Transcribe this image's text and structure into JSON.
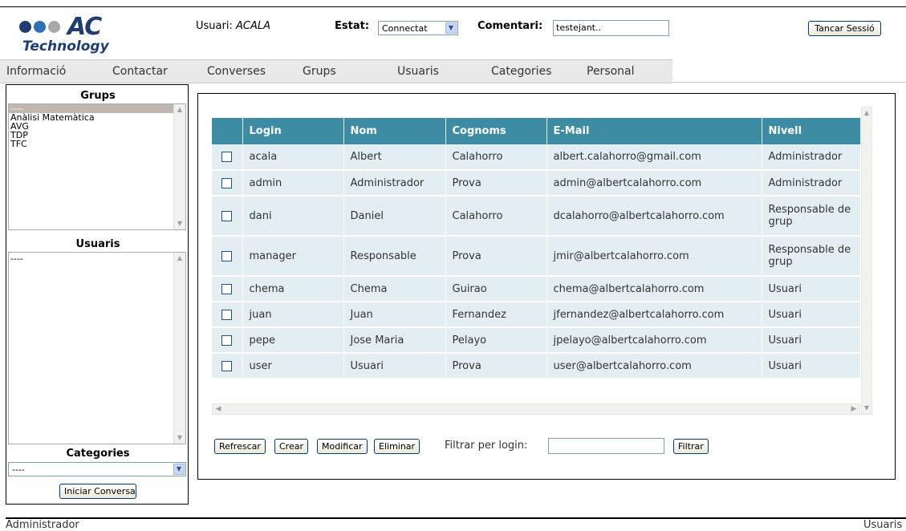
{
  "logo": {
    "brand": "AC",
    "tagline": "Technology",
    "dot_colors": [
      "#1f3d72",
      "#2f6fb4",
      "#a8a8a8"
    ]
  },
  "header": {
    "user_label": "Usuari:",
    "user_value": "ACALA",
    "status_label": "Estat:",
    "status_value": "Connectat",
    "comment_label": "Comentari:",
    "comment_value": "testejant..",
    "logout_label": "Tancar Sessió"
  },
  "menu": [
    "Informació",
    "Contactar",
    "Converses",
    "Grups",
    "Usuaris",
    "Categories",
    "Personal"
  ],
  "sidebar": {
    "groups_title": "Grups",
    "groups": [
      "----",
      "Anàlisi Matemàtica",
      "AVG",
      "TDP",
      "TFC"
    ],
    "users_title": "Usuaris",
    "users": [
      "----"
    ],
    "categories_title": "Categories",
    "categories_value": "----",
    "start_conversation_label": "Iniciar Conversa"
  },
  "table": {
    "headers": [
      "Login",
      "Nom",
      "Cognoms",
      "E-Mail",
      "Nivell"
    ],
    "rows": [
      [
        "acala",
        "Albert",
        "Calahorro",
        "albert.calahorro@gmail.com",
        "Administrador"
      ],
      [
        "admin",
        "Administrador",
        "Prova",
        "admin@albertcalahorro.com",
        "Administrador"
      ],
      [
        "dani",
        "Daniel",
        "Calahorro",
        "dcalahorro@albertcalahorro.com",
        "Responsable de grup"
      ],
      [
        "manager",
        "Responsable",
        "Prova",
        "jmir@albertcalahorro.com",
        "Responsable de grup"
      ],
      [
        "chema",
        "Chema",
        "Guirao",
        "chema@albertcalahorro.com",
        "Usuari"
      ],
      [
        "juan",
        "Juan",
        "Fernandez",
        "jfernandez@albertcalahorro.com",
        "Usuari"
      ],
      [
        "pepe",
        "Jose Maria",
        "Pelayo",
        "jpelayo@albertcalahorro.com",
        "Usuari"
      ],
      [
        "user",
        "Usuari",
        "Prova",
        "user@albertcalahorro.com",
        "Usuari"
      ]
    ]
  },
  "actions": {
    "refresh": "Refrescar",
    "create": "Crear",
    "modify": "Modificar",
    "delete": "Eliminar",
    "filter_label": "Filtrar per login:",
    "filter_value": "",
    "filter_button": "Filtrar"
  },
  "footer": {
    "left": "Administrador",
    "right": "Usuaris"
  }
}
